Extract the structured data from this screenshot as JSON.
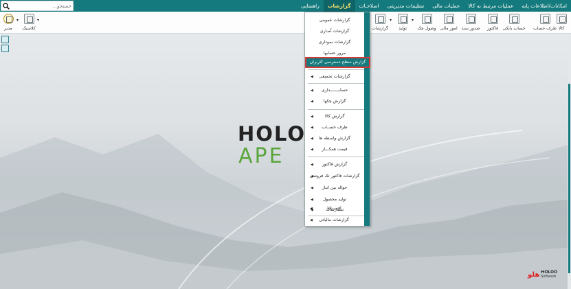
{
  "menubar": {
    "items": [
      {
        "label": "امکانات/اطلاعات پایه"
      },
      {
        "label": "عملیات مرتبط به کالا"
      },
      {
        "label": "عملیات مالی"
      },
      {
        "label": "تنظیمات مدیریتی"
      },
      {
        "label": "اصلاحـات"
      },
      {
        "label": "گزارشات",
        "active": true
      },
      {
        "label": "راهنمایی"
      }
    ],
    "search_placeholder": "جستجو..."
  },
  "toolbar": {
    "items": [
      {
        "label": "کالا",
        "icon": "box-icon"
      },
      {
        "label": "طرف حساب",
        "icon": "person-icon"
      },
      {
        "label": "حساب بانکی",
        "icon": "bank-icon"
      },
      {
        "label": "فاکتور",
        "icon": "invoice-icon"
      },
      {
        "label": "صدور سند",
        "icon": "document-icon"
      },
      {
        "label": "امور مالی",
        "icon": "finance-icon"
      },
      {
        "label": "وصول چک",
        "icon": "cheque-icon"
      },
      {
        "label": "تولید",
        "icon": "production-icon"
      },
      {
        "label": "گزارشات",
        "icon": "report-icon"
      }
    ],
    "left_items": [
      {
        "label": "مدیر",
        "icon": "user-circle-icon"
      },
      {
        "label": "کلاسیک",
        "icon": "classic-view-icon"
      }
    ]
  },
  "dropdown": {
    "items": [
      {
        "label": "گزارشات عمومی",
        "arrow": false
      },
      {
        "label": "گزارشات آمـاری",
        "arrow": false
      },
      {
        "label": "گزارشات نموداری",
        "arrow": false
      },
      {
        "label": "مرور حسابها",
        "arrow": false
      },
      {
        "label": "گزارش سطح دسترسی کاربران",
        "arrow": false,
        "highlighted": true
      },
      {
        "label": "گزارشات تجمیعی",
        "arrow": true
      },
      {
        "label": "حسابـــــــداری",
        "arrow": true
      },
      {
        "label": "گزارش چکها",
        "arrow": true
      },
      {
        "label": "گزارش کالا",
        "arrow": true
      },
      {
        "label": "طرف حســاب",
        "arrow": true
      },
      {
        "label": "گزارش واسطه ها",
        "arrow": true
      },
      {
        "label": "قیمت همکـــار",
        "arrow": true
      },
      {
        "label": "گزارش فاکتور",
        "arrow": true
      },
      {
        "label": "گزارشات فاکتور تک فروشی",
        "arrow": true
      },
      {
        "label": "حواله بین انبار",
        "arrow": true
      },
      {
        "label": "تولید محصول",
        "arrow": true
      },
      {
        "label": "سفارشات",
        "arrow": true
      },
      {
        "label": "اقســاط",
        "arrow": true
      },
      {
        "label": "گزارشات مالیاتی",
        "arrow": true
      }
    ]
  },
  "background": {
    "logo_line1": "HOLO",
    "logo_line2": "APE",
    "corner_mark": "هلو",
    "corner_brand": "HOLOO",
    "corner_sub": "Software"
  }
}
